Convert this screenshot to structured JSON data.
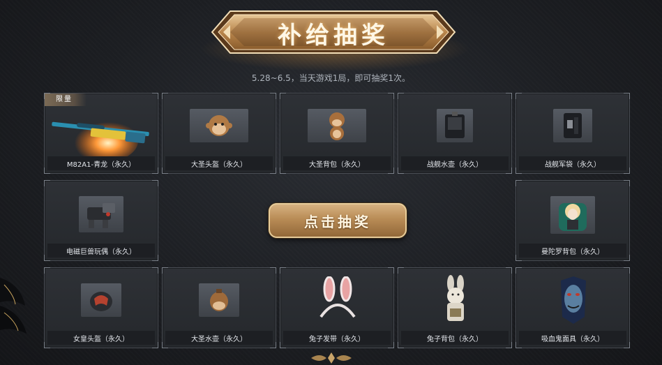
{
  "banner": {
    "title": "补给抽奖"
  },
  "subtitle": "5.28~6.5，当天游戏1局，即可抽奖1次。",
  "draw_button": {
    "label": "点击抽奖"
  },
  "prizes": [
    {
      "name": "M82A1-青龙（永久）",
      "badge": "限量",
      "icon": "sniper-rifle-icon"
    },
    {
      "name": "大圣头盔（永久）",
      "icon": "monkey-helmet-icon"
    },
    {
      "name": "大圣背包（永久）",
      "icon": "monkey-backpack-icon"
    },
    {
      "name": "战舰水壶（永久）",
      "icon": "battleship-canteen-icon"
    },
    {
      "name": "战舰军袋（永久）",
      "icon": "battleship-pouch-icon"
    },
    {
      "name": "电磁巨兽玩偶（永久）",
      "icon": "mech-beast-doll-icon"
    },
    {
      "name": "曼陀罗背包（永久）",
      "icon": "doll-backpack-icon"
    },
    {
      "name": "女皇头盔（永久）",
      "icon": "empress-helmet-icon"
    },
    {
      "name": "大圣水壶（永久）",
      "icon": "monkey-canteen-icon"
    },
    {
      "name": "兔子发带（永久）",
      "icon": "bunny-headband-icon"
    },
    {
      "name": "兔子背包（永久）",
      "icon": "bunny-backpack-icon"
    },
    {
      "name": "吸血鬼面具（永久）",
      "icon": "vampire-mask-icon"
    }
  ]
}
